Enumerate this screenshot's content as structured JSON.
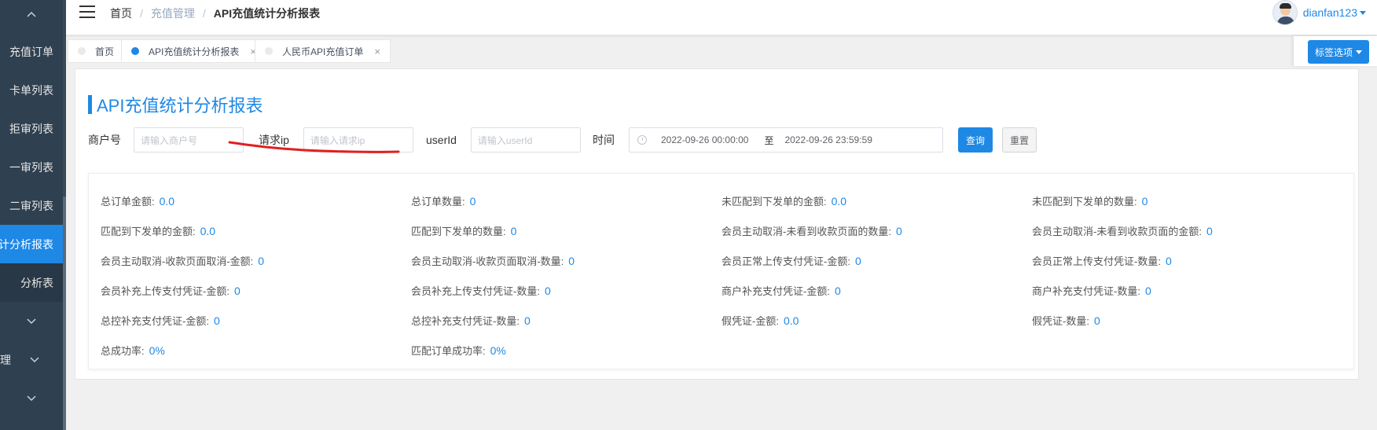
{
  "sidebar": {
    "items": [
      {
        "label": "充值订单"
      },
      {
        "label": "卡单列表"
      },
      {
        "label": "拒审列表"
      },
      {
        "label": "一审列表"
      },
      {
        "label": "二审列表"
      },
      {
        "label": "计分析报表"
      },
      {
        "label": "分析表"
      },
      {
        "label": "理"
      }
    ]
  },
  "header": {
    "breadcrumb": [
      "首页",
      "充值管理",
      "API充值统计分析报表"
    ],
    "username": "dianfan123"
  },
  "tabs": [
    {
      "label": "首页",
      "active": false,
      "closable": false
    },
    {
      "label": "API充值统计分析报表",
      "active": true,
      "closable": true
    },
    {
      "label": "人民币API充值订单",
      "active": false,
      "closable": true
    }
  ],
  "tab_options_label": "标签选项",
  "page": {
    "title": "API充值统计分析报表"
  },
  "filters": {
    "merchant_label": "商户号",
    "merchant_placeholder": "请输入商户号",
    "ip_label": "请求ip",
    "ip_placeholder": "请输入请求ip",
    "userid_label": "userId",
    "userid_placeholder": "请输入userId",
    "time_label": "时间",
    "date_start": "2022-09-26 00:00:00",
    "date_sep": "至",
    "date_end": "2022-09-26 23:59:59",
    "query_label": "查询",
    "reset_label": "重置"
  },
  "stats": [
    {
      "label": "总订单金额:",
      "value": "0.0"
    },
    {
      "label": "总订单数量:",
      "value": "0"
    },
    {
      "label": "未匹配到下发单的金额:",
      "value": "0.0"
    },
    {
      "label": "未匹配到下发单的数量:",
      "value": "0"
    },
    {
      "label": "匹配到下发单的金额:",
      "value": "0.0"
    },
    {
      "label": "匹配到下发单的数量:",
      "value": "0"
    },
    {
      "label": "会员主动取消-未看到收款页面的数量:",
      "value": "0"
    },
    {
      "label": "会员主动取消-未看到收款页面的金额:",
      "value": "0"
    },
    {
      "label": "会员主动取消-收款页面取消-金额:",
      "value": "0"
    },
    {
      "label": "会员主动取消-收款页面取消-数量:",
      "value": "0"
    },
    {
      "label": "会员正常上传支付凭证-金额:",
      "value": "0"
    },
    {
      "label": "会员正常上传支付凭证-数量:",
      "value": "0"
    },
    {
      "label": "会员补充上传支付凭证-金额:",
      "value": "0"
    },
    {
      "label": "会员补充上传支付凭证-数量:",
      "value": "0"
    },
    {
      "label": "商户补充支付凭证-金额:",
      "value": "0"
    },
    {
      "label": "商户补充支付凭证-数量:",
      "value": "0"
    },
    {
      "label": "总控补充支付凭证-金额:",
      "value": "0"
    },
    {
      "label": "总控补充支付凭证-数量:",
      "value": "0"
    },
    {
      "label": "假凭证-金额:",
      "value": "0.0"
    },
    {
      "label": "假凭证-数量:",
      "value": "0"
    },
    {
      "label": "总成功率:",
      "value": "0%"
    },
    {
      "label": "匹配订单成功率:",
      "value": "0%"
    }
  ],
  "colors": {
    "accent": "#1e88e5",
    "sidebar_bg": "#2f4050",
    "annotation": "#e02020"
  }
}
